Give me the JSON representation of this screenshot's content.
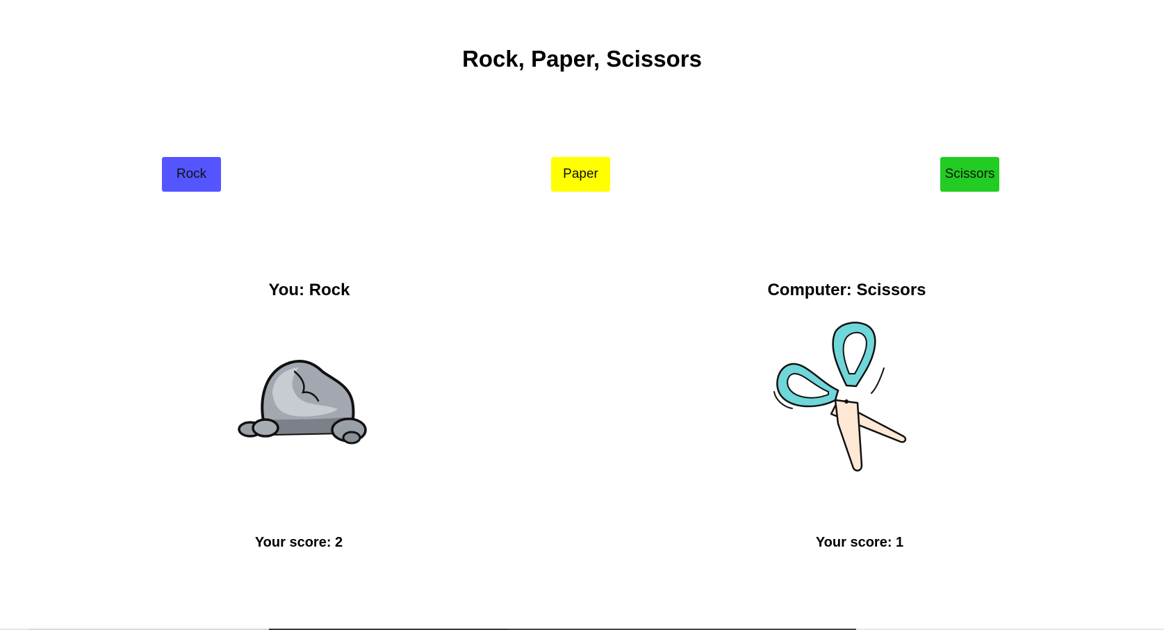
{
  "game": {
    "title": "Rock, Paper, Scissors"
  },
  "controls": {
    "buttons": [
      {
        "label": "Rock",
        "color": "#5555ff"
      },
      {
        "label": "Paper",
        "color": "#ffff00"
      },
      {
        "label": "Scissors",
        "color": "#22cc22"
      }
    ]
  },
  "player": {
    "heading": "You: Rock",
    "choice_icon": "rock-icon",
    "score_text": "Your score: 2"
  },
  "computer": {
    "heading": "Computer: Scissors",
    "choice_icon": "scissors-icon",
    "score_text": "Your score: 1"
  }
}
